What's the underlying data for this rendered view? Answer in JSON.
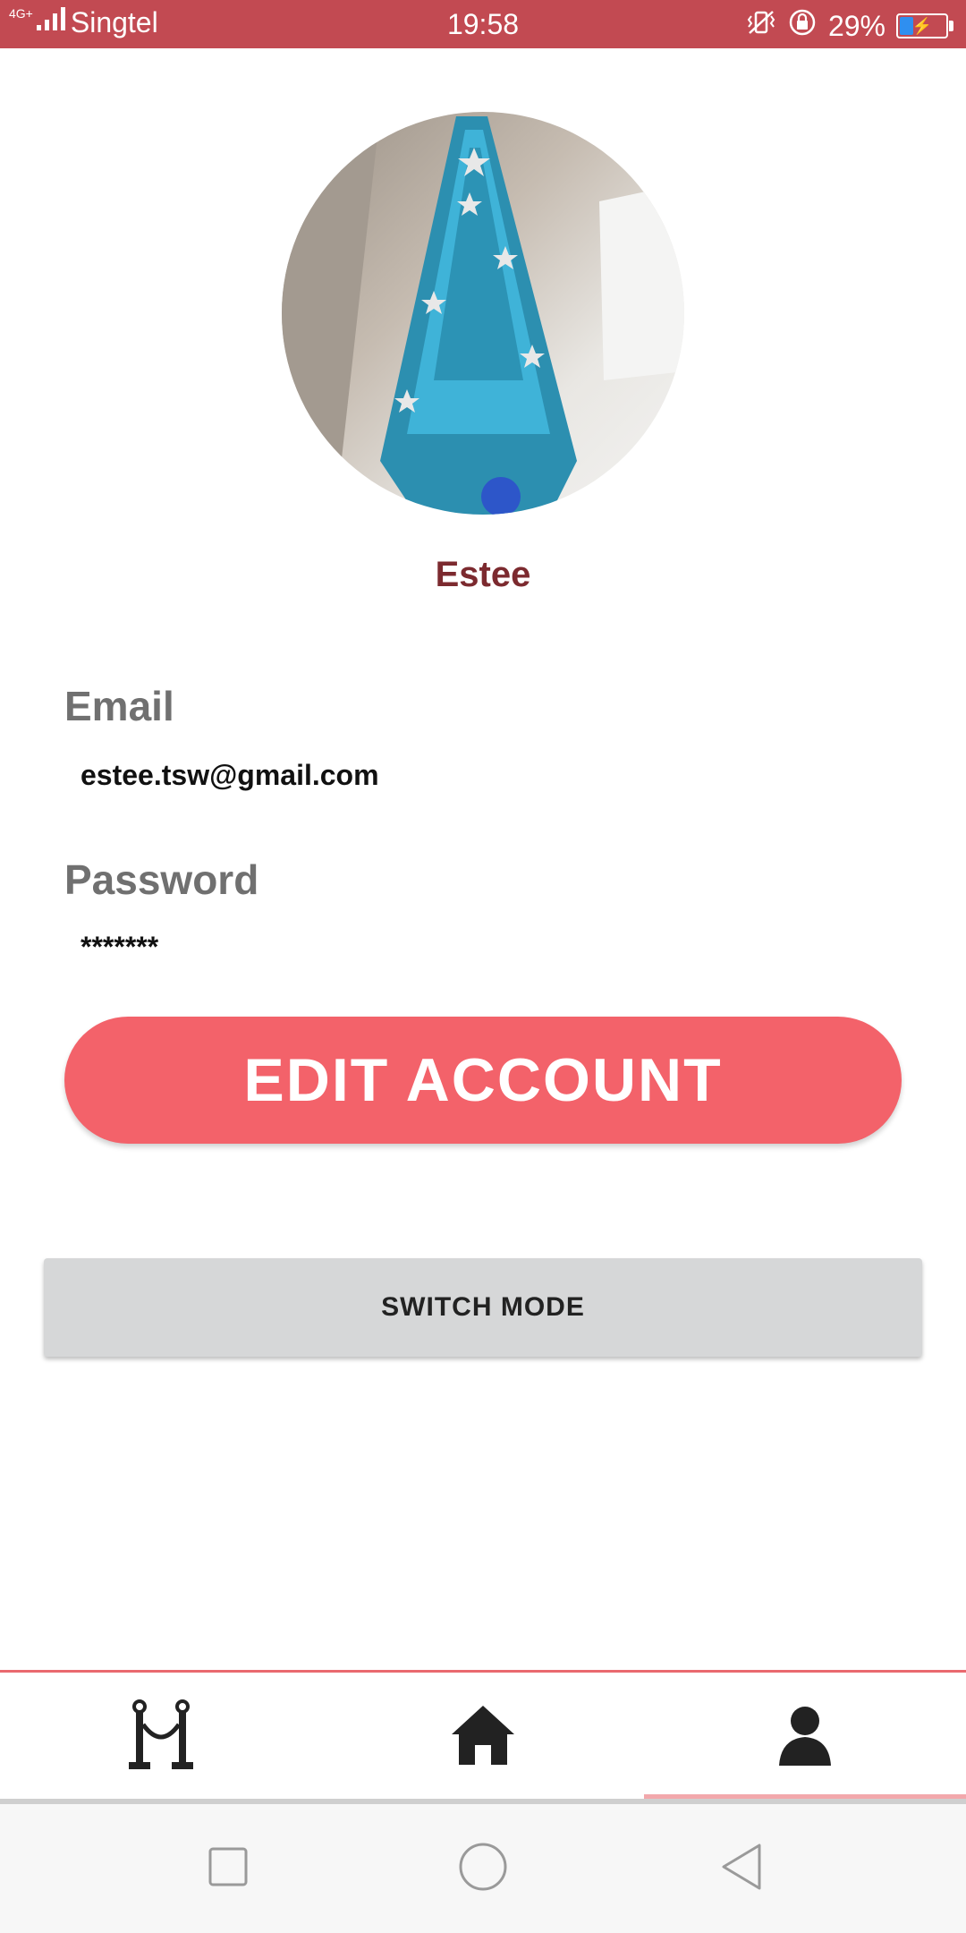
{
  "status_bar": {
    "network": "4G+",
    "carrier": "Singtel",
    "time": "19:58",
    "battery_percent_label": "29%",
    "battery_level": 0.29
  },
  "profile": {
    "name": "Estee",
    "avatar_icon": "profile-photo"
  },
  "fields": {
    "email_label": "Email",
    "email_value": "estee.tsw@gmail.com",
    "password_label": "Password",
    "password_value": "*******"
  },
  "buttons": {
    "edit_account": "EDIT ACCOUNT",
    "switch_mode": "SWITCH MODE"
  },
  "bottom_nav": {
    "items": [
      {
        "icon": "stanchion-rope-icon",
        "selected": false
      },
      {
        "icon": "home-icon",
        "selected": false
      },
      {
        "icon": "person-icon",
        "selected": true
      }
    ]
  },
  "colors": {
    "status_bar": "#c24a52",
    "accent": "#f3626a",
    "name": "#7c2a2f",
    "label": "#707070"
  }
}
